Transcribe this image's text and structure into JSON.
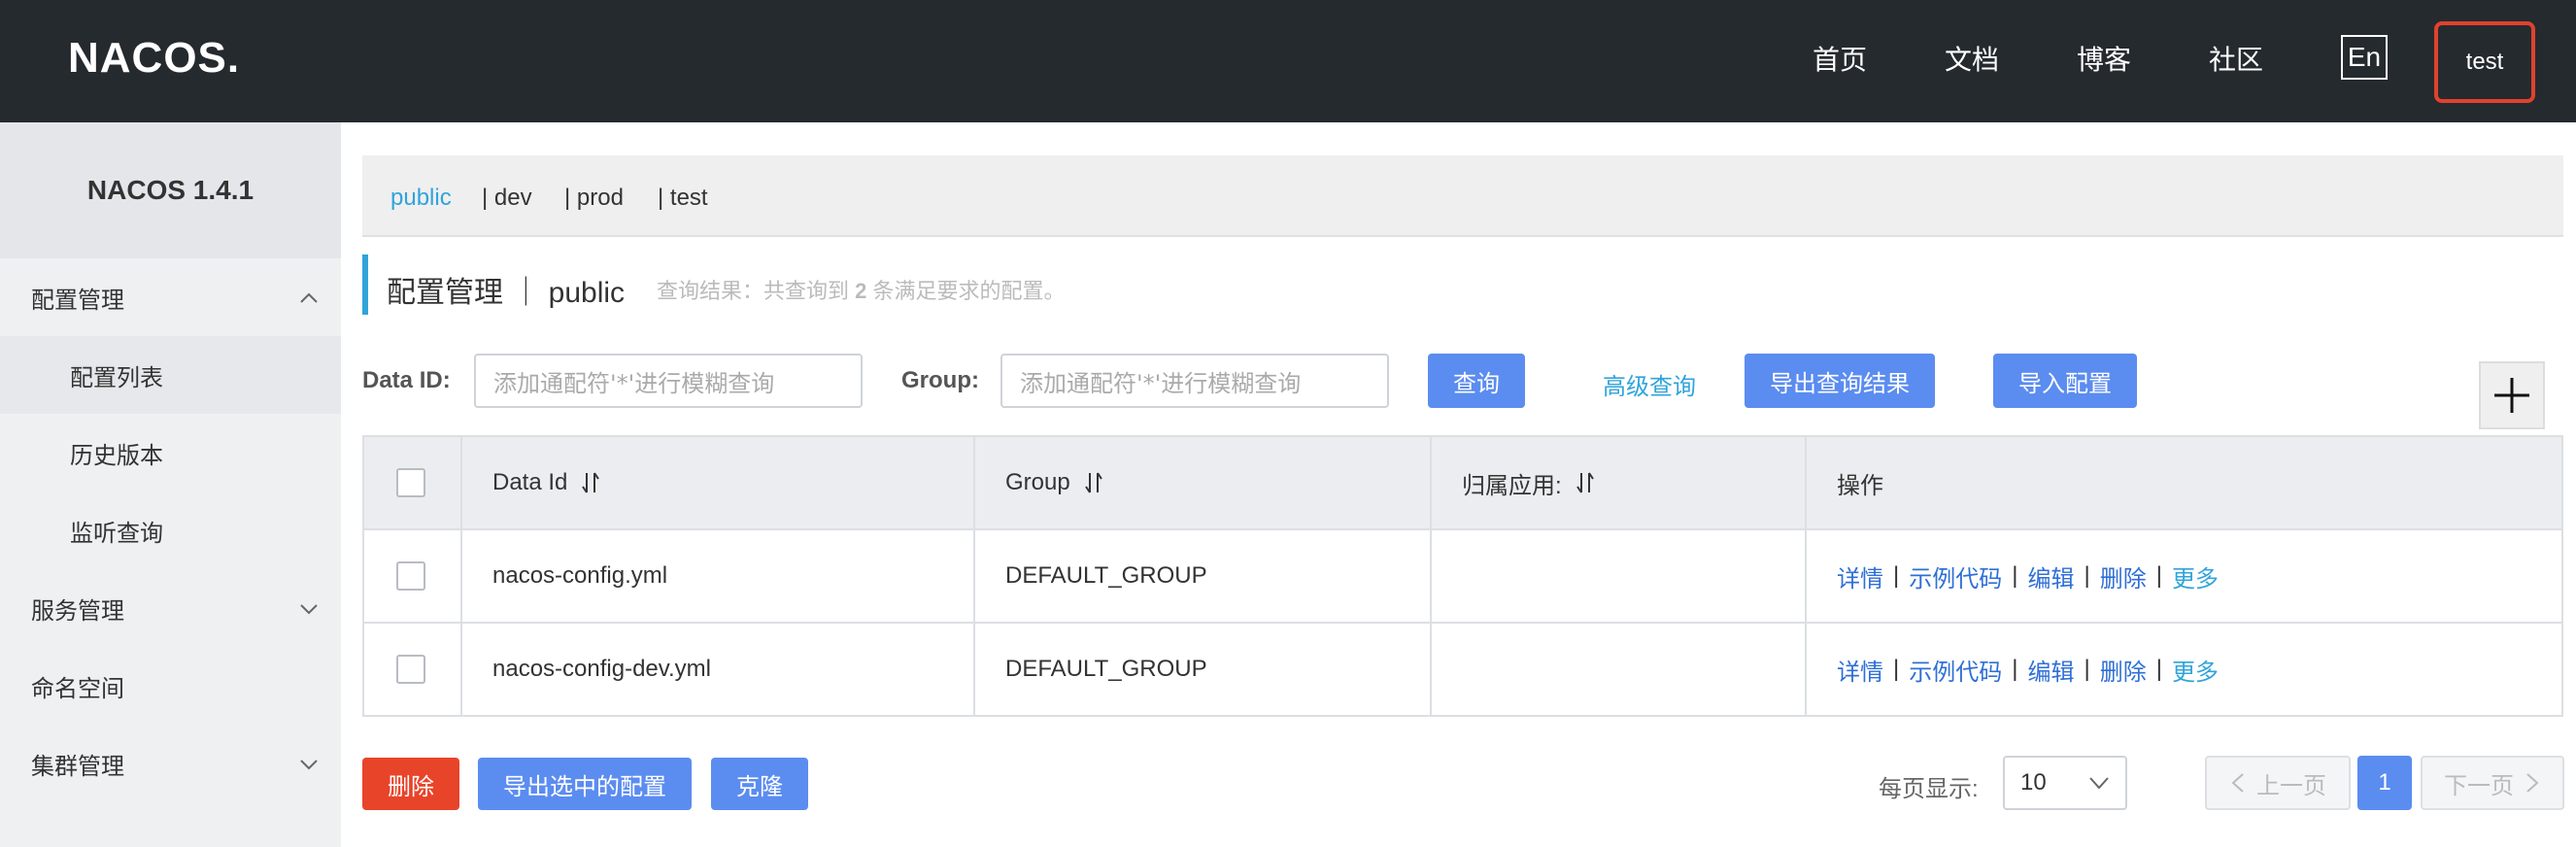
{
  "header": {
    "logo_text": "NACOS.",
    "nav": [
      "首页",
      "文档",
      "博客",
      "社区"
    ],
    "lang_label": "En",
    "user_label": "test"
  },
  "sidebar": {
    "version": "NACOS 1.4.1",
    "items": [
      {
        "label": "配置管理",
        "icon": "chevron-up-icon"
      },
      {
        "label": "配置列表"
      },
      {
        "label": "历史版本"
      },
      {
        "label": "监听查询"
      },
      {
        "label": "服务管理",
        "icon": "chevron-down-icon"
      },
      {
        "label": "命名空间"
      },
      {
        "label": "集群管理",
        "icon": "chevron-down-icon"
      }
    ]
  },
  "namespaces": [
    "public",
    "| dev",
    "| prod",
    "| test"
  ],
  "title": {
    "text": "配置管理 ｜ public",
    "result_prefix": "查询结果：共查询到",
    "result_count": "2",
    "result_suffix": "条满足要求的配置。"
  },
  "search": {
    "dataid_label": "Data ID:",
    "dataid_placeholder": "添加通配符'*'进行模糊查询",
    "group_label": "Group:",
    "group_placeholder": "添加通配符'*'进行模糊查询",
    "query_btn": "查询",
    "advanced_link": "高级查询",
    "export_btn": "导出查询结果",
    "import_btn": "导入配置"
  },
  "table": {
    "columns": [
      "Data Id",
      "Group",
      "归属应用:",
      "操作"
    ],
    "rows": [
      {
        "data_id": "nacos-config.yml",
        "group": "DEFAULT_GROUP",
        "app": ""
      },
      {
        "data_id": "nacos-config-dev.yml",
        "group": "DEFAULT_GROUP",
        "app": ""
      }
    ],
    "ops": {
      "detail": "详情",
      "sample": "示例代码",
      "edit": "编辑",
      "delete": "删除",
      "more": "更多",
      "sep": "|"
    }
  },
  "footer": {
    "delete_btn": "删除",
    "export_selected_btn": "导出选中的配置",
    "clone_btn": "克隆",
    "per_page_label": "每页显示:",
    "per_page_value": "10",
    "prev_label": "上一页",
    "current_page": "1",
    "next_label": "下一页"
  },
  "colors": {
    "accent": "#30a4da",
    "primary": "#5b8cf0",
    "danger": "#e8442a",
    "topbar": "#252a2f"
  }
}
